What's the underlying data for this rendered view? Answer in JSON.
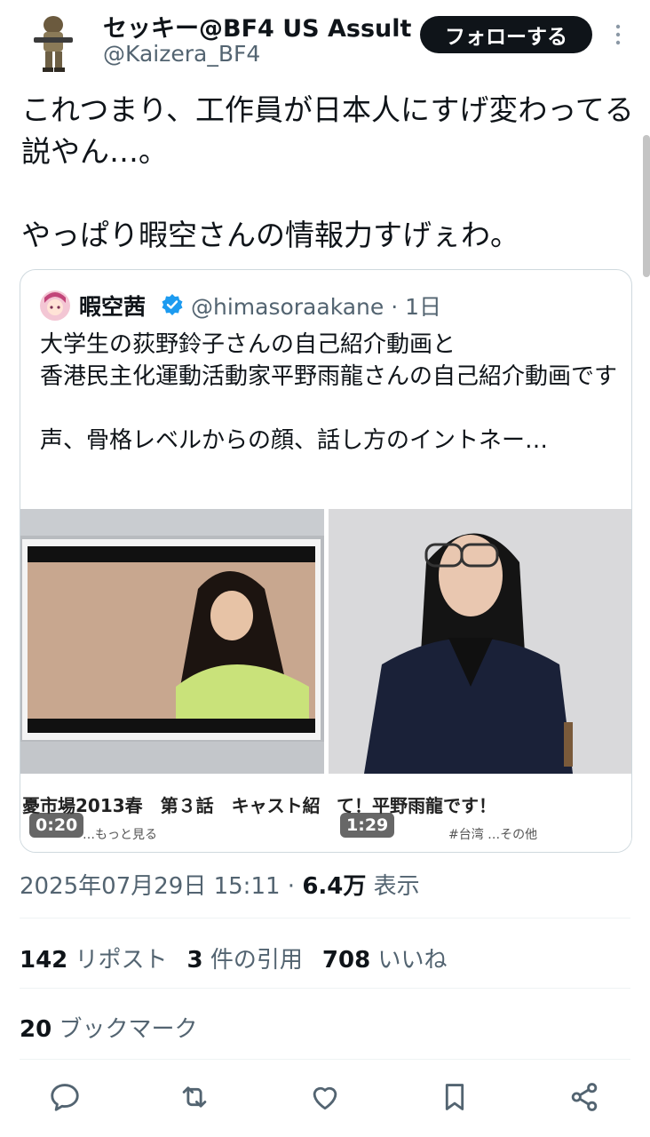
{
  "author": {
    "display_name": "セッキー@BF4 US Assult",
    "handle": "@Kaizera_BF4",
    "follow_label": "フォローする"
  },
  "tweet": {
    "text": "これつまり、工作員が日本人にすげ変わってる説やん…。\n\nやっぱり暇空さんの情報力すげぇわ。"
  },
  "quoted": {
    "name": "暇空茜",
    "handle_time": "@himasoraakane · 1日",
    "text": "大学生の荻野鈴子さんの自己紹介動画と\n香港民主化運動活動家平野雨龍さんの自己紹介動画です\n\n声、骨格レベルからの顔、話し方のイントネー…",
    "media": [
      {
        "caption": "憂市場2013春　第３話　キャスト紹",
        "subtitle": "…もっと見る",
        "duration": "0:20"
      },
      {
        "caption": "て！平野雨龍です！",
        "subtitle": "#台湾 …その他",
        "duration": "1:29"
      }
    ]
  },
  "meta": {
    "datetime": "2025年07月29日 15:11 · ",
    "views": "6.4万",
    "views_label": " 表示"
  },
  "stats": {
    "reposts": "142",
    "reposts_label": " リポスト",
    "quotes": "3",
    "quotes_label": " 件の引用",
    "likes": "708",
    "likes_label": " いいね",
    "bookmarks": "20",
    "bookmarks_label": " ブックマーク"
  },
  "icons": {
    "actions": [
      "reply-icon",
      "repost-icon",
      "like-icon",
      "bookmark-icon",
      "share-icon"
    ],
    "verified": "verified-badge-icon",
    "more": "more-icon"
  },
  "colors": {
    "text": "#0f1419",
    "secondary": "#536471",
    "verified": "#1d9bf0",
    "follow_bg": "#0f1419",
    "divider": "#eff3f4"
  }
}
